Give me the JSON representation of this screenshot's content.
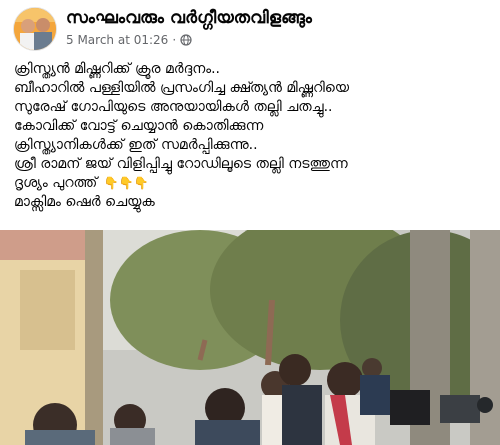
{
  "post": {
    "page_name": "സംഘംവരും വർഗ്ഗീയതവിളങ്ങും",
    "date": "5 March at 01:26",
    "separator": "·",
    "visibility_icon": "globe-icon",
    "lines": [
      "ക്രിസ്ത്യൻ മിഷ്ണറിക്ക് ക്രൂര മർദ്ദനം..",
      "ബീഹാറിൽ പള്ളിയിൽ പ്രസംഗിച്ച ക്ഷ്ത്യൻ മിഷ്ണറിയെ",
      "സുരേഷ് ഗോപിയുടെ അനുയായികൾ തല്ലി ചതച്ചു..",
      "കോവിക്ക് വോട്ട് ചെയ്യാൻ കൊതിക്കുന്ന",
      "ക്രിസ്ത്യാനികൾക്ക് ഇത് സമർപ്പിക്കുന്നു..",
      "ശ്രീ രാമന് ജയ് വിളിപ്പിച്ചു റോഡിലൂടെ തല്ലി നടത്തുന്ന",
      "ദൃശ്യം പുറത്ത്",
      "മാക്സിമം ഷെർ ചെയ്യുക"
    ],
    "emoji": "👇👇👇",
    "photo_icon": "crowd-photo"
  }
}
